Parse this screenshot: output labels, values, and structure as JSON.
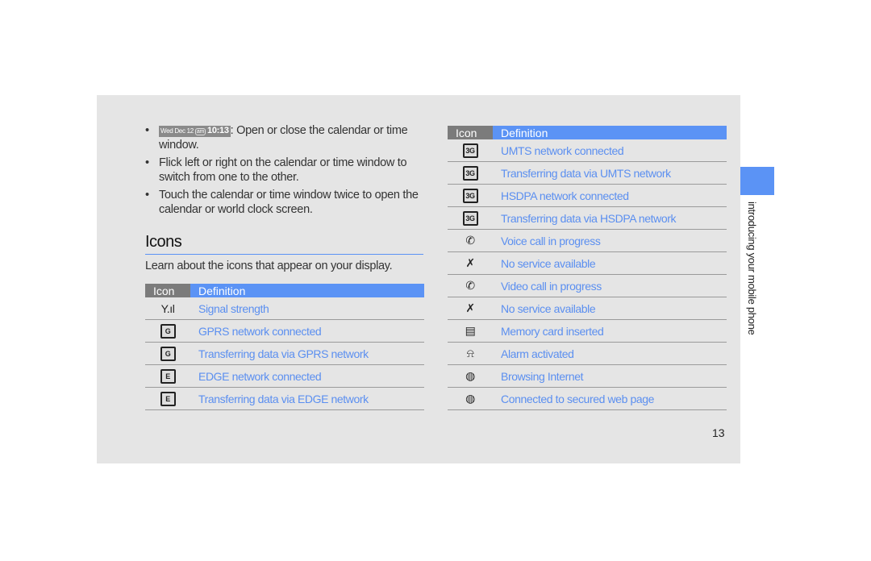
{
  "bullets": [
    {
      "clock": {
        "date": "Wed Dec 12",
        "ampm": "am",
        "time": "10:13"
      },
      "text": ": Open or close the calendar or time window."
    },
    {
      "text": "Flick left or right on the calendar or time window to switch from one to the other."
    },
    {
      "text": "Touch the calendar or time window twice to open the calendar or world clock screen."
    }
  ],
  "section": {
    "title": "Icons",
    "intro": "Learn about the icons that appear on your display."
  },
  "table_headers": {
    "icon": "Icon",
    "definition": "Definition"
  },
  "left_table": [
    {
      "icon": "signal-strength-icon",
      "glyph": "Y.ıl",
      "definition": "Signal strength"
    },
    {
      "icon": "gprs-icon",
      "glyph": "G",
      "definition": "GPRS network connected"
    },
    {
      "icon": "gprs-transfer-icon",
      "glyph": "G",
      "definition": "Transferring data via GPRS network"
    },
    {
      "icon": "edge-icon",
      "glyph": "E",
      "definition": "EDGE network connected"
    },
    {
      "icon": "edge-transfer-icon",
      "glyph": "E",
      "definition": "Transferring data via EDGE network"
    }
  ],
  "right_table": [
    {
      "icon": "umts-icon",
      "glyph": "3G",
      "definition": "UMTS network connected"
    },
    {
      "icon": "umts-transfer-icon",
      "glyph": "3G",
      "definition": "Transferring data via UMTS network"
    },
    {
      "icon": "hsdpa-icon",
      "glyph": "3G",
      "definition": "HSDPA network connected"
    },
    {
      "icon": "hsdpa-transfer-icon",
      "glyph": "3G",
      "definition": "Transferring data via HSDPA network"
    },
    {
      "icon": "voice-call-icon",
      "glyph": "✆",
      "definition": "Voice call in progress"
    },
    {
      "icon": "no-service-icon",
      "glyph": "✗",
      "definition": "No service available"
    },
    {
      "icon": "video-call-icon",
      "glyph": "✆",
      "definition": "Video call in progress"
    },
    {
      "icon": "no-video-service-icon",
      "glyph": "✗",
      "definition": "No service available"
    },
    {
      "icon": "memory-card-icon",
      "glyph": "▤",
      "definition": "Memory card inserted"
    },
    {
      "icon": "alarm-icon",
      "glyph": "⍾",
      "definition": "Alarm activated"
    },
    {
      "icon": "browsing-internet-icon",
      "glyph": "◍",
      "definition": "Browsing Internet"
    },
    {
      "icon": "secured-web-icon",
      "glyph": "◍",
      "definition": "Connected to secured web page"
    }
  ],
  "side_tab": {
    "label": "introducing your mobile phone",
    "color": "#5b93f5"
  },
  "page_number": "13"
}
